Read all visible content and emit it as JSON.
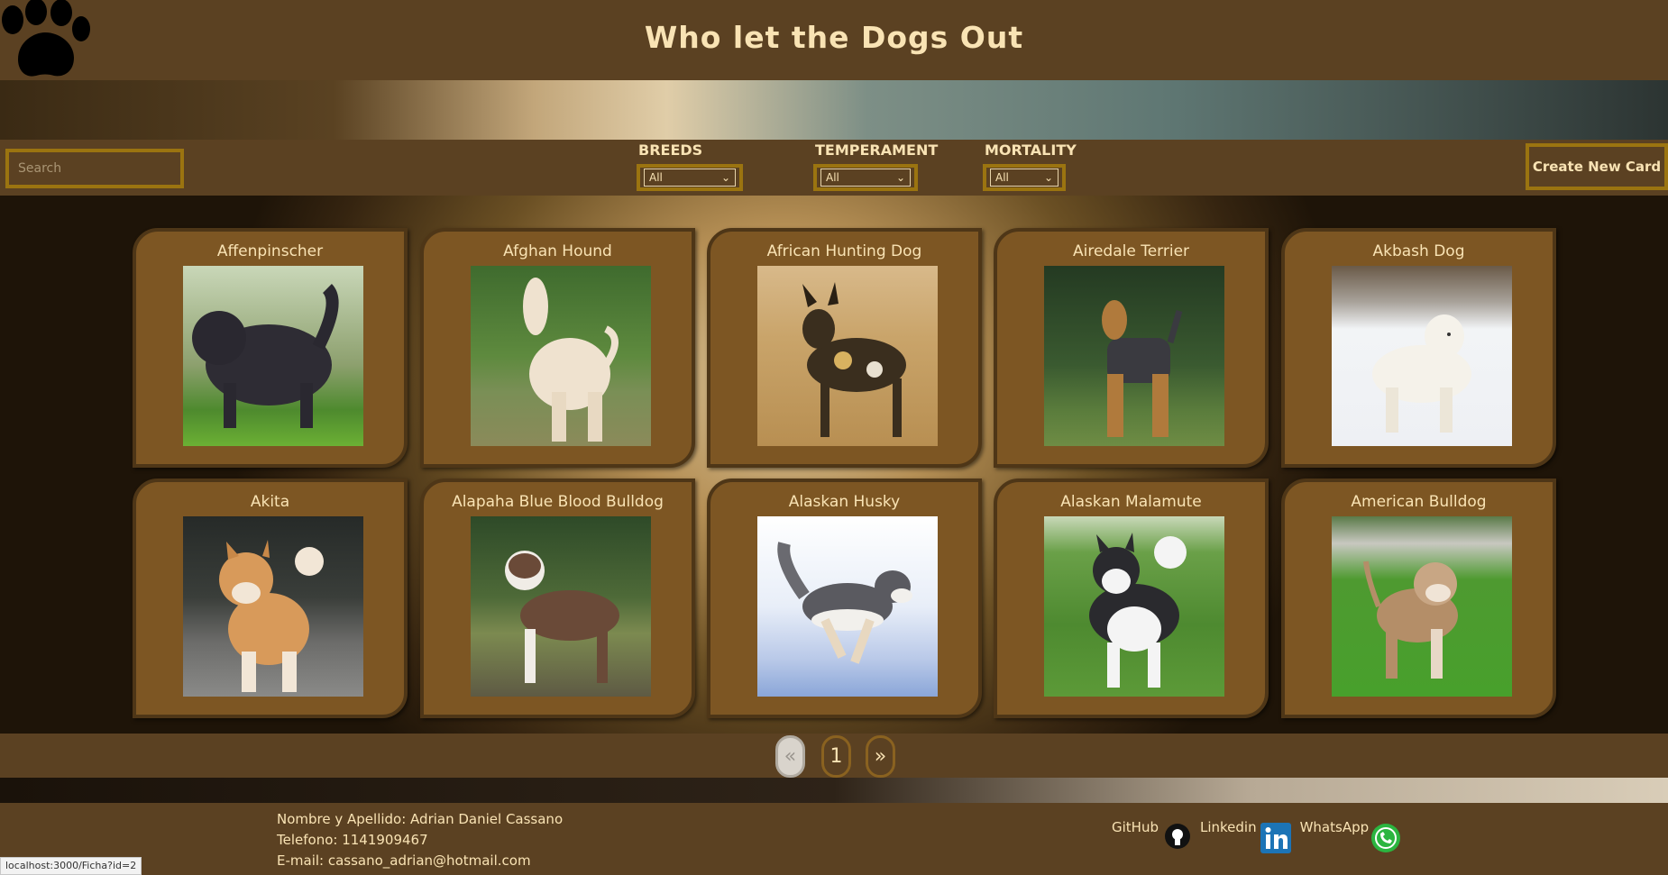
{
  "header": {
    "title": "Who let the Dogs Out"
  },
  "search": {
    "placeholder": "Search"
  },
  "filters": [
    {
      "label": "BREEDS",
      "selected": "All"
    },
    {
      "label": "TEMPERAMENT",
      "selected": "All"
    },
    {
      "label": "MORTALITY",
      "selected": "All"
    }
  ],
  "create_button": "Create New Card",
  "cards": [
    {
      "name": "Affenpinscher"
    },
    {
      "name": "Afghan Hound"
    },
    {
      "name": "African Hunting Dog"
    },
    {
      "name": "Airedale Terrier"
    },
    {
      "name": "Akbash Dog"
    },
    {
      "name": "Akita"
    },
    {
      "name": "Alapaha Blue Blood Bulldog"
    },
    {
      "name": "Alaskan Husky"
    },
    {
      "name": "Alaskan Malamute"
    },
    {
      "name": "American Bulldog"
    }
  ],
  "pagination": {
    "prev": "«",
    "page": "1",
    "next": "»"
  },
  "footer": {
    "name_line": "Nombre y Apellido: Adrian Daniel Cassano",
    "phone_line": "Telefono: 1141909467",
    "email_line": "E-mail: cassano_adrian@hotmail.com",
    "links": [
      "GitHub",
      "Linkedin",
      "WhatsApp"
    ]
  },
  "status_url": "localhost:3000/Ficha?id=2",
  "colors": {
    "header_bg": "#5b4122",
    "card_bg": "#7d5623",
    "accent_border": "#9b7410",
    "text": "#f9e3b4"
  }
}
